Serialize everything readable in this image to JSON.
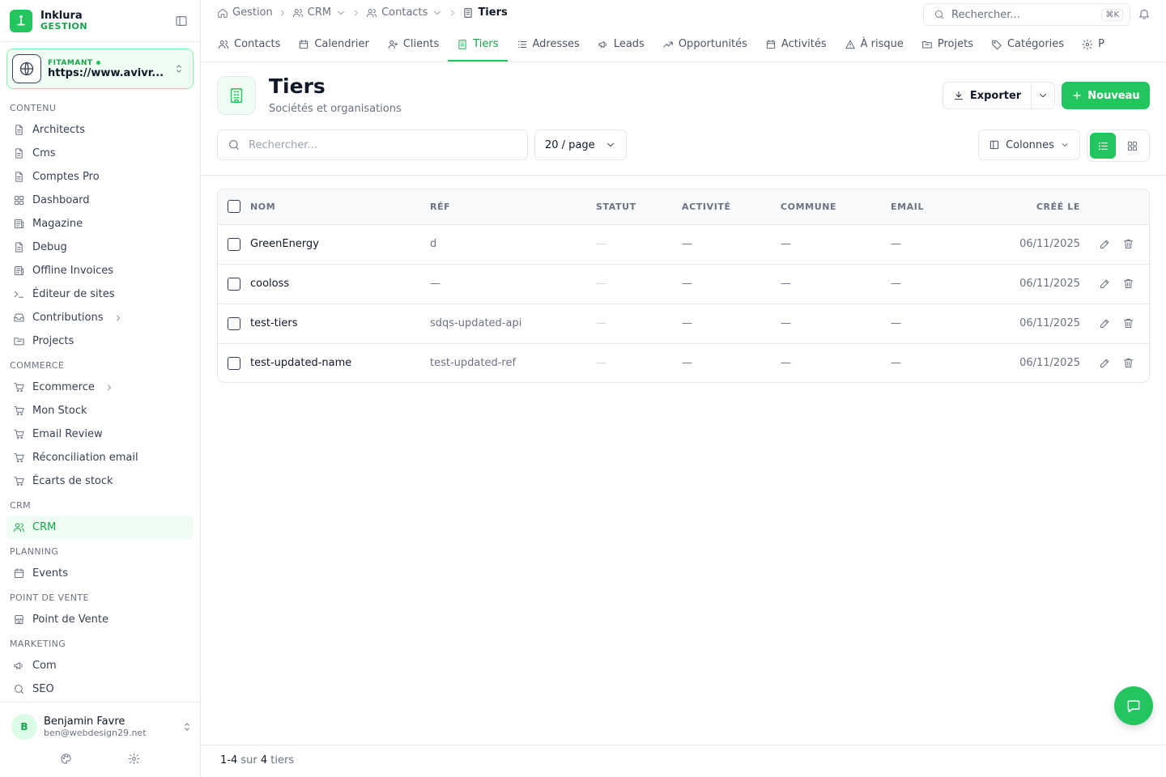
{
  "brand": {
    "name": "Inklura",
    "sub": "GESTION"
  },
  "tenant": {
    "label": "FITAMANT",
    "url": "https://www.avivr..."
  },
  "sidebar": {
    "sections": [
      {
        "title": "CONTENU",
        "items": [
          {
            "label": "Architects",
            "icon": "document-icon"
          },
          {
            "label": "Cms",
            "icon": "document-icon"
          },
          {
            "label": "Comptes Pro",
            "icon": "document-icon"
          },
          {
            "label": "Dashboard",
            "icon": "grid-icon"
          },
          {
            "label": "Magazine",
            "icon": "newspaper-icon"
          },
          {
            "label": "Debug",
            "icon": "document-icon"
          },
          {
            "label": "Offline Invoices",
            "icon": "newspaper-icon"
          },
          {
            "label": "Éditeur de sites",
            "icon": "terminal-icon"
          },
          {
            "label": "Contributions",
            "icon": "inbox-icon",
            "expandable": true
          },
          {
            "label": "Projects",
            "icon": "folder-icon"
          }
        ]
      },
      {
        "title": "COMMERCE",
        "items": [
          {
            "label": "Ecommerce",
            "icon": "cart-icon",
            "expandable": true
          },
          {
            "label": "Mon Stock",
            "icon": "cart-icon"
          },
          {
            "label": "Email Review",
            "icon": "cart-icon"
          },
          {
            "label": "Réconciliation email",
            "icon": "cart-icon"
          },
          {
            "label": "Écarts de stock",
            "icon": "cart-icon"
          }
        ]
      },
      {
        "title": "CRM",
        "items": [
          {
            "label": "CRM",
            "icon": "users-icon",
            "active": true
          }
        ]
      },
      {
        "title": "PLANNING",
        "items": [
          {
            "label": "Events",
            "icon": "calendar-icon"
          }
        ]
      },
      {
        "title": "POINT DE VENTE",
        "items": [
          {
            "label": "Point de Vente",
            "icon": "store-icon"
          }
        ]
      },
      {
        "title": "MARKETING",
        "items": [
          {
            "label": "Com",
            "icon": "megaphone-icon"
          },
          {
            "label": "SEO",
            "icon": "search-icon"
          }
        ]
      }
    ]
  },
  "user": {
    "initial": "B",
    "name": "Benjamin Favre",
    "email": "ben@webdesign29.net"
  },
  "breadcrumb": {
    "home": "Gestion",
    "crm": "CRM",
    "contacts": "Contacts",
    "current": "Tiers"
  },
  "global_search": {
    "placeholder": "Rechercher...",
    "shortcut": "⌘K"
  },
  "tabs": [
    {
      "label": "Contacts",
      "icon": "users-icon"
    },
    {
      "label": "Calendrier",
      "icon": "calendar-icon"
    },
    {
      "label": "Clients",
      "icon": "user-plus-icon"
    },
    {
      "label": "Tiers",
      "icon": "building-icon",
      "active": true
    },
    {
      "label": "Adresses",
      "icon": "list-icon"
    },
    {
      "label": "Leads",
      "icon": "megaphone-icon"
    },
    {
      "label": "Opportunités",
      "icon": "trend-icon"
    },
    {
      "label": "Activités",
      "icon": "calendar-icon"
    },
    {
      "label": "À risque",
      "icon": "warning-icon"
    },
    {
      "label": "Projets",
      "icon": "folder-icon"
    },
    {
      "label": "Catégories",
      "icon": "tag-icon"
    },
    {
      "label": "P",
      "icon": "gear-icon"
    }
  ],
  "page": {
    "title": "Tiers",
    "subtitle": "Sociétés et organisations"
  },
  "actions": {
    "export": "Exporter",
    "new": "Nouveau"
  },
  "toolbar": {
    "search_placeholder": "Rechercher...",
    "per_page": "20 / page",
    "columns": "Colonnes"
  },
  "table": {
    "headers": {
      "nom": "NOM",
      "ref": "RÉF",
      "statut": "STATUT",
      "activite": "ACTIVITÉ",
      "commune": "COMMUNE",
      "email": "EMAIL",
      "cree": "CRÉÉ LE"
    },
    "rows": [
      {
        "nom": "GreenEnergy",
        "ref": "d",
        "statut": "—",
        "activite": "—",
        "commune": "—",
        "email": "—",
        "cree": "06/11/2025"
      },
      {
        "nom": "cooloss",
        "ref": "—",
        "statut": "—",
        "activite": "—",
        "commune": "—",
        "email": "—",
        "cree": "06/11/2025"
      },
      {
        "nom": "test-tiers",
        "ref": "sdqs-updated-api",
        "statut": "—",
        "activite": "—",
        "commune": "—",
        "email": "—",
        "cree": "06/11/2025"
      },
      {
        "nom": "test-updated-name",
        "ref": "test-updated-ref",
        "statut": "—",
        "activite": "—",
        "commune": "—",
        "email": "—",
        "cree": "06/11/2025"
      }
    ]
  },
  "footer": {
    "range": "1-4",
    "of": " sur ",
    "total": "4",
    "unit": " tiers"
  },
  "colors": {
    "accent": "#22c55e",
    "accent_dark": "#16a34a",
    "accent_bg": "#f0fdf4",
    "border": "#e5e7eb"
  }
}
